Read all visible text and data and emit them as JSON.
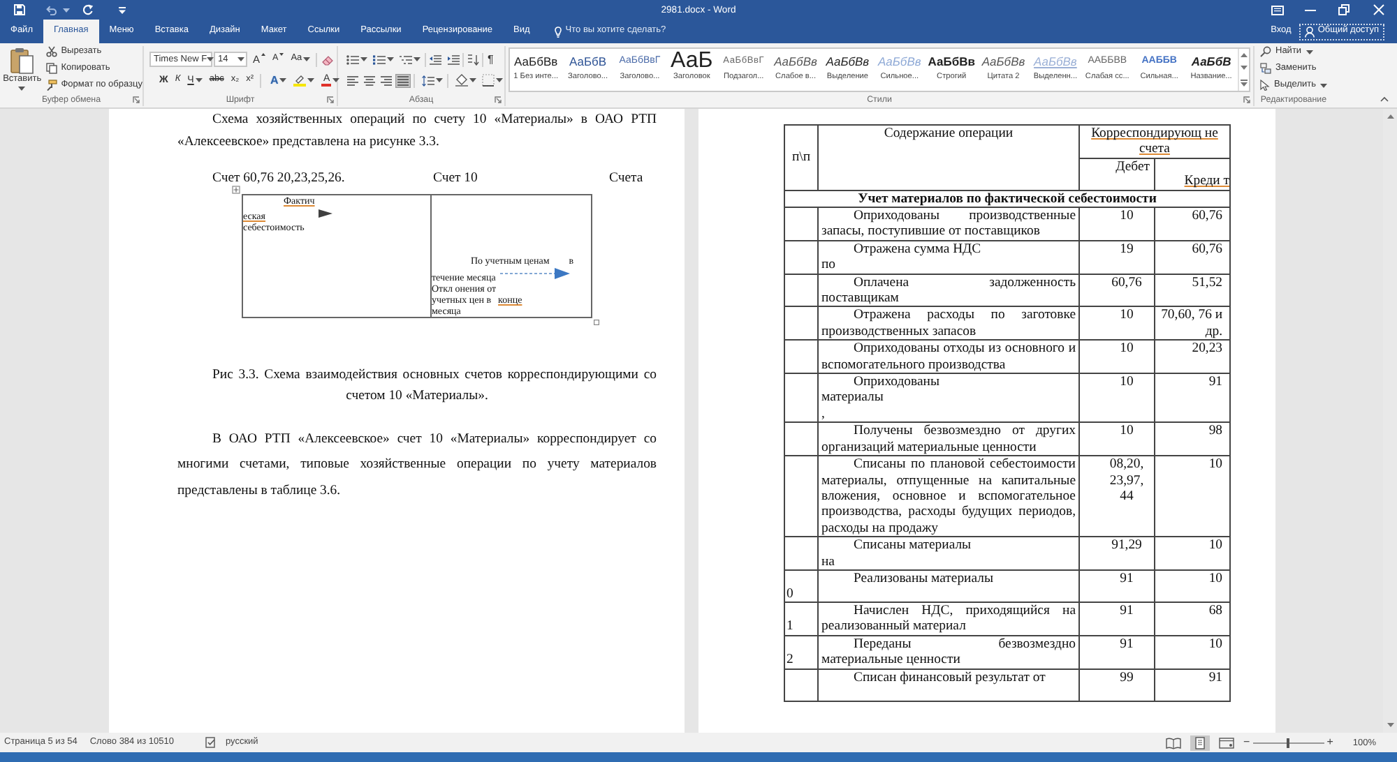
{
  "window": {
    "title": "2981.docx - Word"
  },
  "ribbon_tabs": [
    {
      "label": "Файл",
      "selected": false
    },
    {
      "label": "Главная",
      "selected": true
    },
    {
      "label": "Меню",
      "selected": false
    },
    {
      "label": "Вставка",
      "selected": false
    },
    {
      "label": "Дизайн",
      "selected": false
    },
    {
      "label": "Макет",
      "selected": false
    },
    {
      "label": "Ссылки",
      "selected": false
    },
    {
      "label": "Рассылки",
      "selected": false
    },
    {
      "label": "Рецензирование",
      "selected": false
    },
    {
      "label": "Вид",
      "selected": false
    }
  ],
  "tell_me": {
    "label": "Что вы хотите сделать?"
  },
  "account": {
    "sign_in": "Вход",
    "share": "Общий доступ"
  },
  "clipboard": {
    "paste": "Вставить",
    "commands": [
      {
        "kind": "cut",
        "label": "Вырезать"
      },
      {
        "kind": "copy",
        "label": "Копировать"
      },
      {
        "kind": "format_painter",
        "label": "Формат по образцу"
      }
    ],
    "label": "Буфер обмена"
  },
  "font": {
    "name": "Times New F",
    "size": "14",
    "size_buttons": [
      {
        "kind": "grow",
        "label": "A"
      },
      {
        "kind": "shrink",
        "label": "A"
      },
      {
        "kind": "case",
        "label": "Aa"
      }
    ],
    "format_buttons": [
      {
        "kind": "bold",
        "label": "Ж"
      },
      {
        "kind": "italic",
        "label": "К"
      },
      {
        "kind": "underline",
        "label": "Ч"
      },
      {
        "kind": "strikethrough",
        "label": "abc"
      },
      {
        "kind": "subscript",
        "label": "x₂"
      },
      {
        "kind": "superscript",
        "label": "x²"
      },
      {
        "kind": "text_effects",
        "label": "A"
      },
      {
        "kind": "highlight"
      },
      {
        "kind": "font_color",
        "label": "A"
      }
    ],
    "label": "Шрифт"
  },
  "paragraph": {
    "alignment": [
      {
        "kind": "left",
        "selected": false
      },
      {
        "kind": "center",
        "selected": false
      },
      {
        "kind": "right",
        "selected": false
      },
      {
        "kind": "justify",
        "selected": true
      }
    ],
    "show_marks": "¶",
    "label": "Абзац"
  },
  "styles": {
    "items": [
      {
        "preview": "АаБбВв",
        "name": "1 Без инте...",
        "kind": "normal"
      },
      {
        "preview": "АаБбВ",
        "name": "Заголово...",
        "kind": "heading1"
      },
      {
        "preview": "АаБбВвГ",
        "name": "Заголово...",
        "kind": "heading2"
      },
      {
        "preview": "АаБ",
        "name": "Заголовок",
        "kind": "title"
      },
      {
        "preview": "АаБбВвГ",
        "name": "Подзагол...",
        "kind": "subtitle"
      },
      {
        "preview": "АаБбВв",
        "name": "Слабое в...",
        "kind": "subtle_emphasis"
      },
      {
        "preview": "АаБбВв",
        "name": "Выделение",
        "kind": "emphasis"
      },
      {
        "preview": "АаБбВв",
        "name": "Сильное...",
        "kind": "intense_emphasis"
      },
      {
        "preview": "АаБбВв",
        "name": "Строгий",
        "kind": "strong"
      },
      {
        "preview": "АаБбВв",
        "name": "Цитата 2",
        "kind": "quote"
      },
      {
        "preview": "АаБбВв",
        "name": "Выделенн...",
        "kind": "intense_quote"
      },
      {
        "preview": "ААББВВ",
        "name": "Слабая сс...",
        "kind": "subtle_reference"
      },
      {
        "preview": "ААББВ",
        "name": "Сильная...",
        "kind": "intense_reference"
      },
      {
        "preview": "АаБбВ",
        "name": "Название...",
        "kind": "book_title"
      }
    ],
    "label": "Стили"
  },
  "editing": {
    "commands": [
      {
        "kind": "find",
        "label": "Найти"
      },
      {
        "kind": "replace",
        "label": "Заменить"
      },
      {
        "kind": "select",
        "label": "Выделить"
      }
    ],
    "label": "Редактирование"
  },
  "left_page": {
    "intro": "Схема хозяйственных операций по счету 10 «Материалы» в ОАО РТП «Алексеевское» представлена на рисунке 3.3.",
    "figure": {
      "accounts": [
        "Счет 60,76 20,23,25,26.",
        "Счет 10",
        "Счета"
      ],
      "left_cell": [
        {
          "kind": "solid_arrow",
          "parts": [
            {
              "text": "Фактич",
              "flagged": true
            }
          ]
        },
        {
          "kind": "text",
          "parts": [
            {
              "text": "еская",
              "flagged": true
            }
          ]
        },
        {
          "kind": "text",
          "parts": [
            {
              "text": "себестоимость",
              "flagged": false
            }
          ]
        }
      ],
      "right_cell": [
        {
          "kind": "text",
          "parts": [
            {
              "text": "По учетным ценам",
              "flagged": false
            },
            {
              "text": "в",
              "flagged": false
            }
          ]
        },
        {
          "kind": "dashed_arrow",
          "parts": [
            {
              "text": "течение месяца",
              "flagged": false
            }
          ]
        },
        {
          "kind": "text",
          "parts": [
            {
              "text": "Откл онения от",
              "flagged": false
            }
          ]
        },
        {
          "kind": "text",
          "parts": [
            {
              "text": "учетных цен в",
              "flagged": false
            },
            {
              "text": "конце",
              "flagged": true
            }
          ]
        },
        {
          "kind": "text",
          "parts": [
            {
              "text": "месяца",
              "flagged": false
            }
          ]
        }
      ]
    },
    "caption": "Рис 3.3. Схема взаимодействия основных счетов корреспондирующими со счетом 10 «Материалы».",
    "paragraph": "В ОАО РТП «Алексеевское» счет 10 «Материалы» корреспондирует со многими счетами, типовые хозяйственные операции по учету материалов представлены в таблице 3.6."
  },
  "right_page": {
    "table": {
      "columns": [
        {
          "label": "п\\п",
          "flagged": false
        },
        {
          "label": "Содержание операции",
          "flagged": false
        },
        {
          "label": "Корреспондирующ не счета",
          "flagged": true
        }
      ],
      "subcolumns": [
        {
          "label": "Дебет",
          "flagged": false
        },
        {
          "label": "Креди т",
          "flagged": true
        }
      ],
      "section": "Учет материалов по фактической себестоимости",
      "rows": [
        {
          "operation": "Оприходованы производственные запасы, поступившие от поставщиков",
          "debit": "10",
          "credit": "60,76"
        },
        {
          "operation": "Отражена сумма НДС\nпо",
          "debit": "19",
          "credit": "60,76"
        },
        {
          "operation": "Оплачена задолженность поставщикам",
          "debit": "60,76",
          "credit": "51,52"
        },
        {
          "operation": "Отражена расходы по заготовке производственных запасов",
          "debit": "10",
          "credit": "70,60, 76 и др."
        },
        {
          "operation": "Оприходованы отходы из основного и вспомогательного производства",
          "debit": "10",
          "credit": "20,23"
        },
        {
          "operation": "Оприходованы\nматериалы\n,",
          "debit": "10",
          "credit": "91"
        },
        {
          "operation": "Получены безвозмездно от других организаций материальные ценности",
          "debit": "10",
          "credit": "98"
        },
        {
          "operation": "Списаны по плановой себестоимости материалы, отпущенные на капитальные вложения, основное и вспомогательное производства, расходы будущих периодов, расходы на продажу",
          "debit": "08,20, 23,97, 44",
          "credit": "10"
        },
        {
          "operation": "Списаны материалы\nна",
          "debit": "91,29",
          "credit": "10"
        },
        {
          "number": "0",
          "operation": "Реализованы материалы",
          "debit": "91",
          "credit": "10"
        },
        {
          "number": "1",
          "operation": "Начислен НДС, приходящийся на реализованный материал",
          "debit": "91",
          "credit": "68"
        },
        {
          "number": "2",
          "operation": "Переданы безвозмездно материальные ценности",
          "debit": "91",
          "credit": "10"
        },
        {
          "operation": "Списан финансовый результат от",
          "debit": "99",
          "credit": "91"
        }
      ]
    }
  },
  "status_bar": {
    "page": "Страница 5 из 54",
    "words": "Слово 384 из 10510",
    "language": "русский",
    "views": [
      {
        "kind": "read",
        "selected": false
      },
      {
        "kind": "print",
        "selected": true
      },
      {
        "kind": "web",
        "selected": false
      }
    ],
    "zoom_out": "−",
    "zoom_in": "+",
    "zoom": {
      "level": 0.5,
      "reading": "100%"
    }
  }
}
